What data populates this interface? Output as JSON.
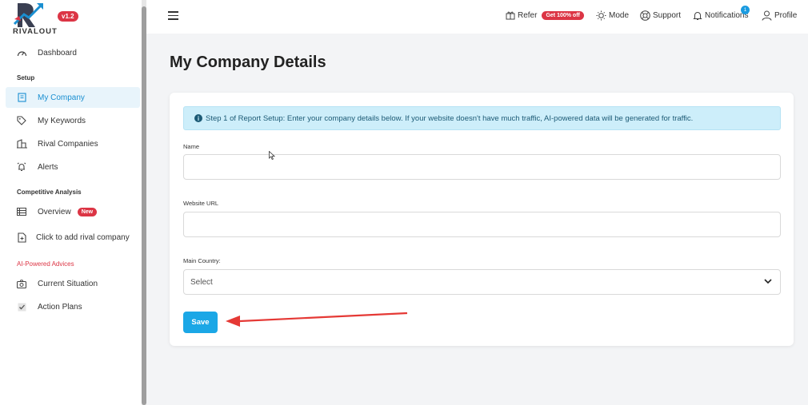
{
  "brand": {
    "logo_text": "RIVALOUT",
    "version": "v1.2"
  },
  "sidebar": {
    "items": [
      {
        "label": "Dashboard",
        "icon": "gauge-icon"
      },
      {
        "label": "My Company",
        "icon": "building-card-icon",
        "active": true
      },
      {
        "label": "My Keywords",
        "icon": "tag-icon"
      },
      {
        "label": "Rival Companies",
        "icon": "buildings-icon"
      },
      {
        "label": "Alerts",
        "icon": "alarm-bell-icon"
      },
      {
        "label": "Overview",
        "icon": "list-table-icon",
        "badge": "New"
      },
      {
        "label": "Click to add rival company",
        "icon": "add-document-icon"
      },
      {
        "label": "Current Situation",
        "icon": "camera-icon"
      },
      {
        "label": "Action Plans",
        "icon": "check-icon"
      }
    ],
    "sections": {
      "setup": "Setup",
      "competitive": "Competitive Analysis",
      "ai": "AI-Powered Advices"
    }
  },
  "topbar": {
    "refer": "Refer",
    "refer_badge": "Get 100% off",
    "mode": "Mode",
    "support": "Support",
    "notifications": "Notifications",
    "notifications_count": "1",
    "profile": "Profile"
  },
  "main": {
    "title": "My Company Details",
    "alert": "Step 1 of Report Setup: Enter your company details below. If your website doesn't have much traffic, AI-powered data will be generated for traffic.",
    "fields": {
      "name_label": "Name",
      "name_value": "",
      "url_label": "Website URL",
      "url_value": "",
      "country_label": "Main Country:",
      "country_value": "Select"
    },
    "save_label": "Save"
  },
  "colors": {
    "accent": "#1ba7e6",
    "danger": "#dc3545",
    "alert_bg": "#cdeefa"
  }
}
